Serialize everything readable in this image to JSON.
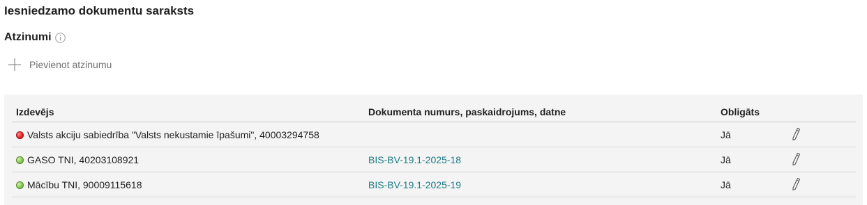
{
  "page": {
    "title": "Iesniedzamo dokumentu saraksts"
  },
  "attachments": {
    "title": "Atzinumi",
    "info_icon": "info-circle-icon",
    "add_label": "Pievienot atzinumu",
    "add_icon": "plus-icon"
  },
  "table": {
    "headers": {
      "issuer": "Izdevējs",
      "document": "Dokumenta numurs, paskaidrojums, datne",
      "required": "Obligāts"
    },
    "rows": [
      {
        "status": "red",
        "issuer": "Valsts akciju sabiedrība \"Valsts nekustamie īpašumi\", 40003294758",
        "document": "",
        "required": "Jā",
        "edit_icon": "pencil-icon"
      },
      {
        "status": "green",
        "issuer": "GASO TNI, 40203108921",
        "document": "BIS-BV-19.1-2025-18",
        "required": "Jā",
        "edit_icon": "pencil-icon"
      },
      {
        "status": "green",
        "issuer": "Mācību TNI, 90009115618",
        "document": "BIS-BV-19.1-2025-19",
        "required": "Jā",
        "edit_icon": "pencil-icon"
      }
    ]
  },
  "colors": {
    "link": "#1b7a84",
    "panel_bg": "#f4f4f4",
    "status_red": "#e02020",
    "status_green": "#7ec24a"
  }
}
